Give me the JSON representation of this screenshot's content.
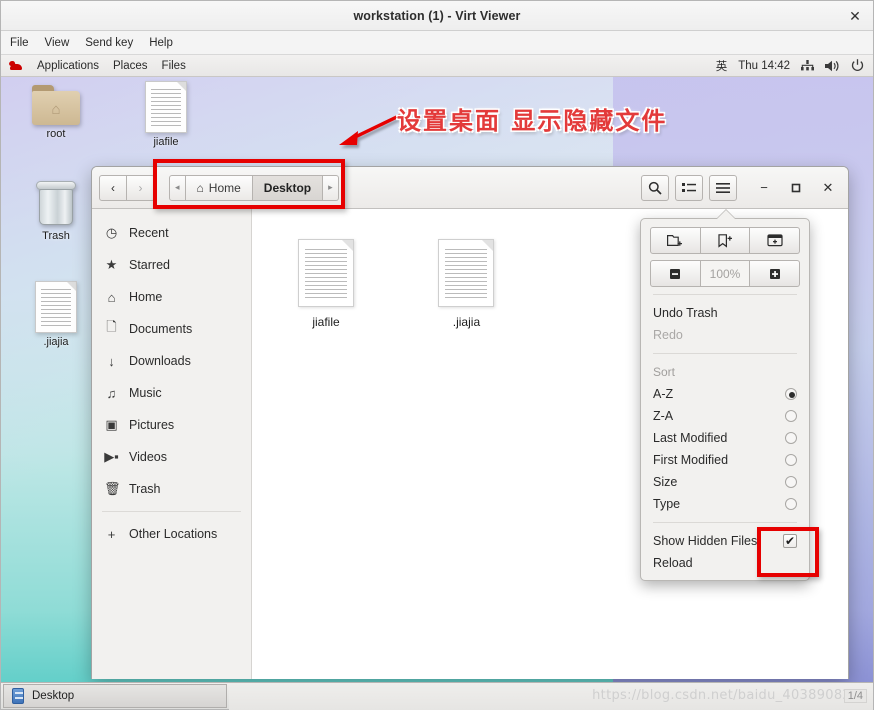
{
  "window": {
    "title": "workstation (1) - Virt Viewer",
    "close_icon": "✕",
    "menus": [
      "File",
      "View",
      "Send key",
      "Help"
    ]
  },
  "gnome_panel": {
    "left_items": [
      "Applications",
      "Places",
      "Files"
    ],
    "logo_icon": "redhat-logo-icon",
    "input_method": "英",
    "clock": "Thu 14:42",
    "tray": [
      "network-icon",
      "volume-icon",
      "power-icon"
    ]
  },
  "desktop": {
    "icons": [
      {
        "label": "root",
        "type": "folder"
      },
      {
        "label": "jiafile",
        "type": "document"
      },
      {
        "label": "Trash",
        "type": "trash"
      },
      {
        "label": ".jiajia",
        "type": "document"
      }
    ]
  },
  "annotation": {
    "text": "设置桌面 显示隐藏文件",
    "color": "#e33a3a",
    "box_color": "#e60000"
  },
  "file_manager": {
    "nav": {
      "back": "‹",
      "forward": "›"
    },
    "breadcrumb": {
      "left_arrow": "◂",
      "right_arrow": "▸",
      "items": [
        {
          "label": "Home",
          "icon": "home-icon",
          "current": false
        },
        {
          "label": "Desktop",
          "icon": "",
          "current": true
        }
      ]
    },
    "header_buttons": [
      {
        "name": "search-button",
        "glyph": "⌕"
      },
      {
        "name": "view-list-button",
        "glyph": "☰"
      },
      {
        "name": "hamburger-menu-button",
        "glyph": "≡"
      }
    ],
    "window_controls": {
      "minimize": "−",
      "maximize": "❑",
      "close": "✕"
    },
    "sidebar": [
      {
        "label": "Recent",
        "icon": "clock-icon"
      },
      {
        "label": "Starred",
        "icon": "star-icon"
      },
      {
        "label": "Home",
        "icon": "home-icon"
      },
      {
        "label": "Documents",
        "icon": "document-icon"
      },
      {
        "label": "Downloads",
        "icon": "download-icon"
      },
      {
        "label": "Music",
        "icon": "music-icon"
      },
      {
        "label": "Pictures",
        "icon": "camera-icon"
      },
      {
        "label": "Videos",
        "icon": "video-icon"
      },
      {
        "label": "Trash",
        "icon": "trash-icon"
      }
    ],
    "sidebar_footer": {
      "label": "Other Locations",
      "icon": "plus-icon"
    },
    "files": [
      {
        "label": "jiafile"
      },
      {
        "label": ".jiajia"
      }
    ]
  },
  "popup_menu": {
    "tool_buttons": [
      {
        "name": "new-folder-button",
        "glyph": "🗀+"
      },
      {
        "name": "new-bookmark-button",
        "glyph": "🔖"
      },
      {
        "name": "new-window-button",
        "glyph": "🗗"
      }
    ],
    "zoom": {
      "out": "−",
      "level": "100%",
      "in": "+"
    },
    "undo": "Undo Trash",
    "redo": "Redo",
    "sort_label": "Sort",
    "sort_options": [
      {
        "label": "A-Z",
        "selected": true
      },
      {
        "label": "Z-A",
        "selected": false
      },
      {
        "label": "Last Modified",
        "selected": false
      },
      {
        "label": "First Modified",
        "selected": false
      },
      {
        "label": "Size",
        "selected": false
      },
      {
        "label": "Type",
        "selected": false
      }
    ],
    "show_hidden": {
      "label": "Show Hidden Files",
      "checked": true
    },
    "reload": "Reload"
  },
  "taskbar": {
    "item": "Desktop",
    "watermark": "https://blog.csdn.net/baidu_40389082",
    "page": "1/4"
  }
}
